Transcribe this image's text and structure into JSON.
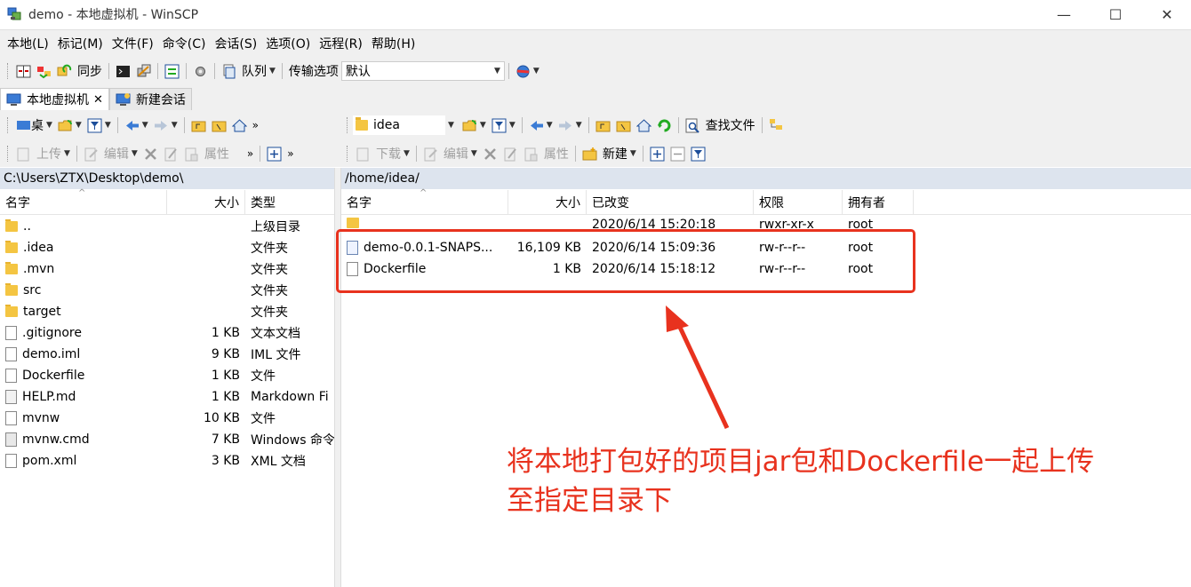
{
  "window": {
    "title": "demo - 本地虚拟机 - WinSCP",
    "min": "—",
    "max": "☐",
    "close": "✕"
  },
  "menu": [
    "本地(L)",
    "标记(M)",
    "文件(F)",
    "命令(C)",
    "会话(S)",
    "选项(O)",
    "远程(R)",
    "帮助(H)"
  ],
  "toolbar1": {
    "sync_label": "同步",
    "queue_label": "队列",
    "transfer_label": "传输选项",
    "transfer_value": "默认"
  },
  "tabs": [
    {
      "label": "本地虚拟机",
      "close": "✕"
    },
    {
      "label": "新建会话"
    }
  ],
  "local": {
    "drive_label": "桌",
    "upload_label": "上传",
    "edit_label": "编辑",
    "props_label": "属性",
    "path": "C:\\Users\\ZTX\\Desktop\\demo\\",
    "columns": [
      "名字",
      "大小",
      "类型"
    ],
    "rows": [
      {
        "name": "..",
        "size": "",
        "type": "上级目录",
        "kind": "up"
      },
      {
        "name": ".idea",
        "size": "",
        "type": "文件夹",
        "kind": "folder"
      },
      {
        "name": ".mvn",
        "size": "",
        "type": "文件夹",
        "kind": "folder"
      },
      {
        "name": "src",
        "size": "",
        "type": "文件夹",
        "kind": "folder"
      },
      {
        "name": "target",
        "size": "",
        "type": "文件夹",
        "kind": "folder"
      },
      {
        "name": ".gitignore",
        "size": "1 KB",
        "type": "文本文档",
        "kind": "file"
      },
      {
        "name": "demo.iml",
        "size": "9 KB",
        "type": "IML 文件",
        "kind": "file"
      },
      {
        "name": "Dockerfile",
        "size": "1 KB",
        "type": "文件",
        "kind": "file"
      },
      {
        "name": "HELP.md",
        "size": "1 KB",
        "type": "Markdown Fi",
        "kind": "md"
      },
      {
        "name": "mvnw",
        "size": "10 KB",
        "type": "文件",
        "kind": "file"
      },
      {
        "name": "mvnw.cmd",
        "size": "7 KB",
        "type": "Windows 命令",
        "kind": "cmd"
      },
      {
        "name": "pom.xml",
        "size": "3 KB",
        "type": "XML 文档",
        "kind": "file"
      }
    ]
  },
  "remote": {
    "dir_label": "idea",
    "download_label": "下载",
    "edit_label": "编辑",
    "props_label": "属性",
    "new_label": "新建",
    "find_label": "查找文件",
    "path": "/home/idea/",
    "columns": [
      "名字",
      "大小",
      "已改变",
      "权限",
      "拥有者"
    ],
    "rows": [
      {
        "name": "",
        "size": "",
        "changed": "2020/6/14 15:20:18",
        "perm": "rwxr-xr-x",
        "owner": "root",
        "kind": "up"
      },
      {
        "name": "demo-0.0.1-SNAPS...",
        "size": "16,109 KB",
        "changed": "2020/6/14 15:09:36",
        "perm": "rw-r--r--",
        "owner": "root",
        "kind": "jar"
      },
      {
        "name": "Dockerfile",
        "size": "1 KB",
        "changed": "2020/6/14 15:18:12",
        "perm": "rw-r--r--",
        "owner": "root",
        "kind": "file"
      }
    ]
  },
  "annotation": {
    "text": "将本地打包好的项目jar包和Dockerfile一起上传至指定目录下",
    "color": "#e8321e"
  }
}
